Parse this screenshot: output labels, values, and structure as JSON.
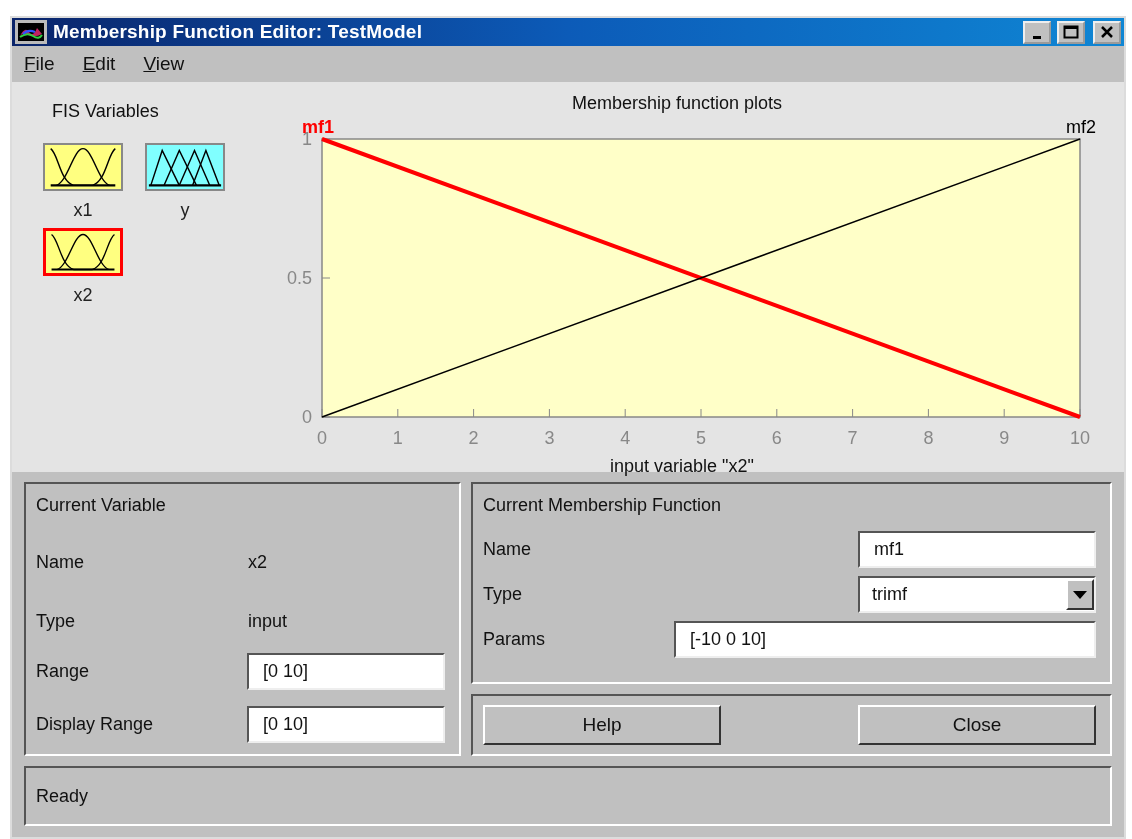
{
  "window": {
    "title": "Membership Function Editor: TestModel"
  },
  "menu": [
    {
      "label": "File"
    },
    {
      "label": "Edit"
    },
    {
      "label": "View"
    }
  ],
  "fis_variables": {
    "title": "FIS Variables",
    "items": [
      {
        "label": "x1",
        "kind": "input",
        "selected": false
      },
      {
        "label": "y",
        "kind": "output",
        "selected": false
      },
      {
        "label": "x2",
        "kind": "input",
        "selected": true
      }
    ]
  },
  "plot": {
    "title": "Membership function plots",
    "chart_data": {
      "type": "line",
      "xlabel": "input variable \"x2\"",
      "x": [
        0,
        10
      ],
      "series": [
        {
          "name": "mf1",
          "color": "#ff0000",
          "values": [
            1,
            0
          ]
        },
        {
          "name": "mf2",
          "color": "#000000",
          "values": [
            0,
            1
          ]
        }
      ],
      "xlim": [
        0,
        10
      ],
      "ylim": [
        0,
        1
      ],
      "xticks": [
        0,
        1,
        2,
        3,
        4,
        5,
        6,
        7,
        8,
        9,
        10
      ],
      "yticks": [
        0,
        0.5,
        1
      ]
    }
  },
  "current_variable": {
    "title": "Current Variable",
    "name_label": "Name",
    "name": "x2",
    "type_label": "Type",
    "type": "input",
    "range_label": "Range",
    "range": "[0 10]",
    "display_range_label": "Display Range",
    "display_range": "[0 10]"
  },
  "current_mf": {
    "title": "Current Membership Function",
    "name_label": "Name",
    "name": "mf1",
    "type_label": "Type",
    "type": "trimf",
    "params_label": "Params",
    "params": "[-10 0 10]"
  },
  "buttons": [
    "Help",
    "Close"
  ],
  "status_bar": "Ready"
}
